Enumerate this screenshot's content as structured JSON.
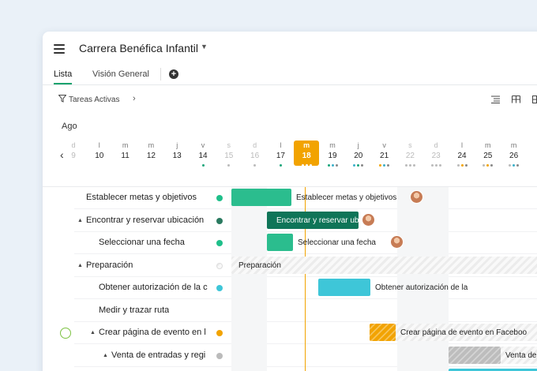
{
  "project": {
    "title": "Carrera Benéfica Infantil"
  },
  "tabs": [
    {
      "label": "Lista",
      "active": true
    },
    {
      "label": "Visión General",
      "active": false
    }
  ],
  "toolbar": {
    "filter_label": "Tareas Activas"
  },
  "timeline": {
    "month": "Ago",
    "days": [
      {
        "l": "d",
        "n": "9",
        "faded": true,
        "dots": []
      },
      {
        "l": "l",
        "n": "10",
        "dots": []
      },
      {
        "l": "m",
        "n": "11",
        "dots": []
      },
      {
        "l": "m",
        "n": "12",
        "dots": []
      },
      {
        "l": "j",
        "n": "13",
        "dots": []
      },
      {
        "l": "v",
        "n": "14",
        "dots": [
          "#1aa67a"
        ]
      },
      {
        "l": "s",
        "n": "15",
        "faded": true,
        "dots": [
          "#bbbbbb"
        ]
      },
      {
        "l": "d",
        "n": "16",
        "faded": true,
        "dots": [
          "#bbbbbb"
        ]
      },
      {
        "l": "l",
        "n": "17",
        "dots": [
          "#1aa67a"
        ]
      },
      {
        "l": "m",
        "n": "18",
        "today": true,
        "dots": [
          "#ffffff",
          "#ffffff",
          "#ffffff"
        ]
      },
      {
        "l": "m",
        "n": "19",
        "dots": [
          "#1aa67a",
          "#3bb0c9",
          "#888888"
        ]
      },
      {
        "l": "j",
        "n": "20",
        "dots": [
          "#3bb0c9",
          "#1aa67a",
          "#888888"
        ]
      },
      {
        "l": "v",
        "n": "21",
        "dots": [
          "#f2a300",
          "#3bb0c9",
          "#888888"
        ]
      },
      {
        "l": "s",
        "n": "22",
        "faded": true,
        "dots": [
          "#bbbbbb",
          "#bbbbbb",
          "#bbbbbb"
        ]
      },
      {
        "l": "d",
        "n": "23",
        "faded": true,
        "dots": [
          "#bbbbbb",
          "#bbbbbb",
          "#bbbbbb"
        ]
      },
      {
        "l": "l",
        "n": "24",
        "dots": [
          "#bbbbbb",
          "#f2a300",
          "#888888"
        ]
      },
      {
        "l": "m",
        "n": "25",
        "dots": [
          "#bbbbbb",
          "#f2a300",
          "#888888"
        ]
      },
      {
        "l": "m",
        "n": "26",
        "dots": [
          "#bbbbbb",
          "#3bb0c9",
          "#888888"
        ]
      }
    ]
  },
  "tasks": [
    {
      "label": "Establecer metas y objetivos",
      "indent": 0,
      "caret": false,
      "status": "#1fbf8a",
      "bar": {
        "start": 0,
        "end": 76,
        "color": "#2bbd8e",
        "label": "Establecer metas y objetivos",
        "avatar": true
      }
    },
    {
      "label": "Encontrar y reservar ubicación",
      "indent": 0,
      "caret": true,
      "status": "#2a7a60",
      "bar": {
        "start": 45,
        "end": 161,
        "color": "#0f7558",
        "label": "Encontrar y reservar ubicación",
        "label_inside": true,
        "avatar": true
      }
    },
    {
      "label": "Seleccionar una fecha",
      "indent": 1,
      "caret": false,
      "status": "#1fbf8a",
      "bar": {
        "start": 45,
        "end": 78,
        "color": "#2bbd8e",
        "label": "Seleccionar una fecha",
        "avatar": true
      }
    },
    {
      "label": "Preparación",
      "indent": 0,
      "caret": true,
      "status": "hatch",
      "bar": {
        "start": 0,
        "end": 401,
        "hatch": true,
        "label": "Preparación",
        "label_inside": true
      }
    },
    {
      "label": "Obtener autorización de la c",
      "indent": 1,
      "caret": false,
      "status": "#3ec6d8",
      "bar": {
        "start": 110,
        "end": 176,
        "color": "#3ec6d8",
        "label": "Obtener autorización de la"
      }
    },
    {
      "label": "Medir y trazar ruta",
      "indent": 1,
      "caret": false,
      "status": "none",
      "bar": null
    },
    {
      "label": "Crear página de evento en l",
      "indent": 1,
      "caret": true,
      "status": "#f2a300",
      "progress_icon": true,
      "bar": {
        "start": 175,
        "end": 208,
        "color": "#f2a300",
        "hatched_color": true,
        "label": "Crear página de evento en Faceboo",
        "trail": true
      }
    },
    {
      "label": "Venta de entradas y regi",
      "indent": 2,
      "caret": true,
      "status": "#bbbbbb",
      "bar": {
        "start": 275,
        "end": 341,
        "color": "#bdbdbd",
        "hatched_color": true,
        "label": "Venta de",
        "trail": true
      }
    },
    {
      "label": "",
      "indent": 2,
      "caret": false,
      "status": "none",
      "bar": {
        "start": 275,
        "end": 401,
        "color": "#3ec6d8"
      }
    }
  ]
}
